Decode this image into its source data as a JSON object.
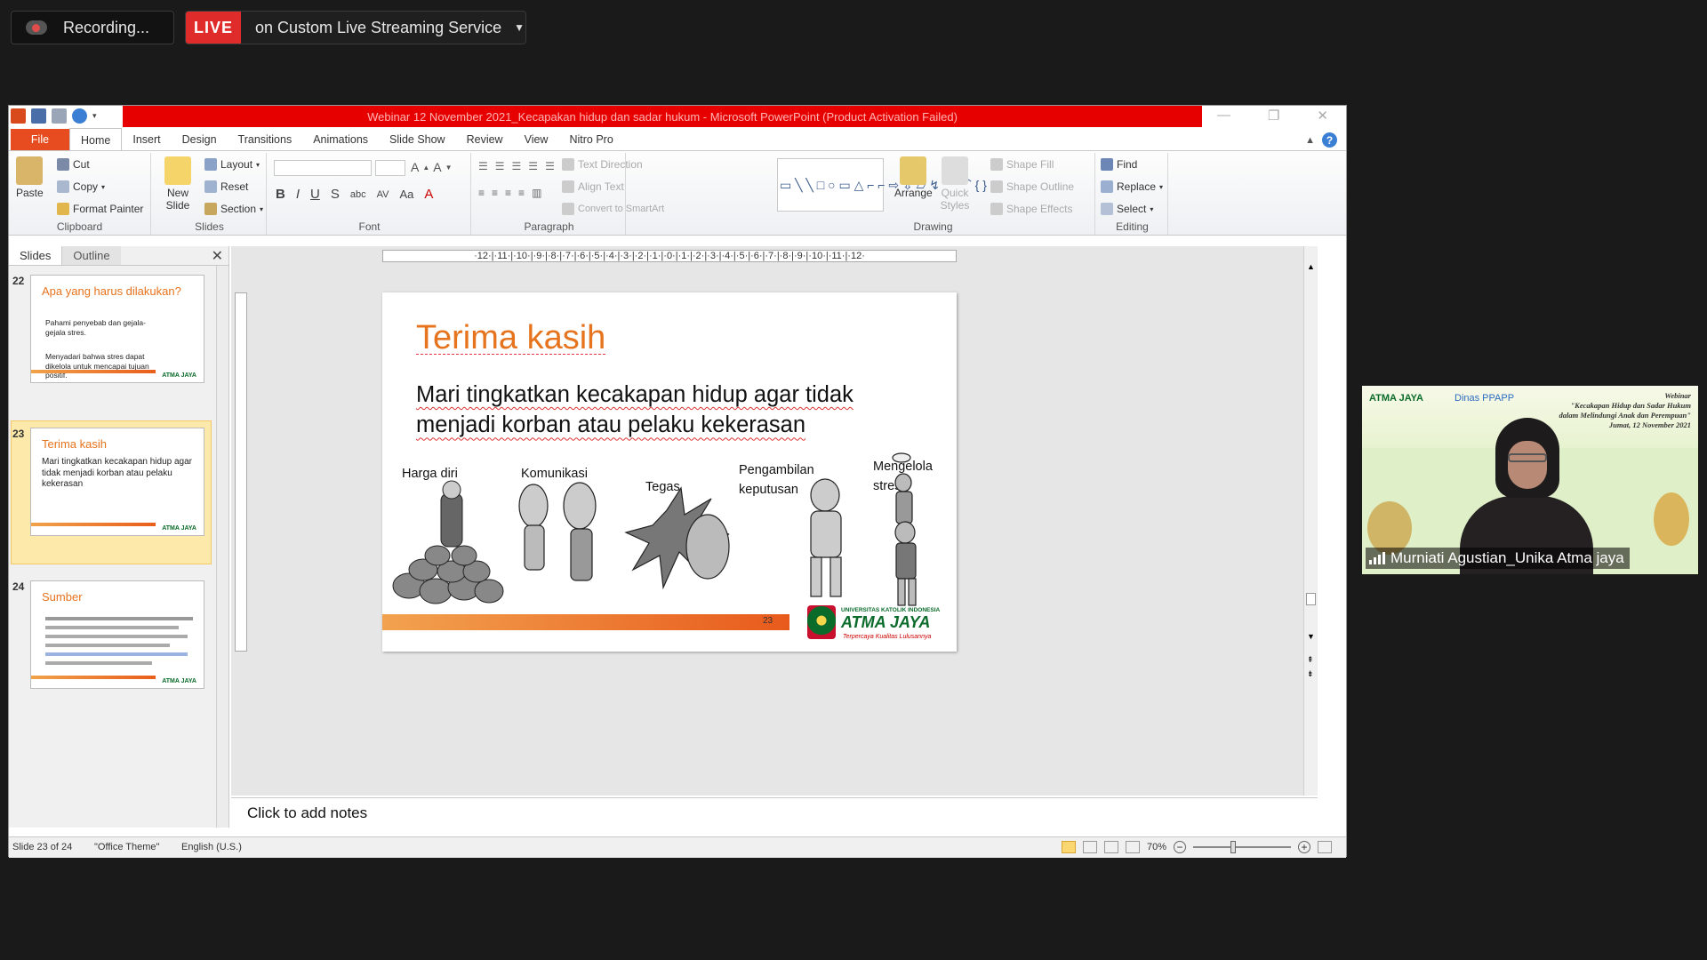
{
  "zoom": {
    "recording_label": "Recording...",
    "live_badge": "LIVE",
    "live_service": "on Custom Live Streaming Service"
  },
  "ppt": {
    "window_title": "Webinar 12 November 2021_Kecapakan hidup dan sadar hukum - Microsoft PowerPoint (Product Activation Failed)",
    "tabs": [
      "File",
      "Home",
      "Insert",
      "Design",
      "Transitions",
      "Animations",
      "Slide Show",
      "Review",
      "View",
      "Nitro Pro"
    ],
    "active_tab": "Home",
    "ribbon": {
      "clipboard": {
        "label": "Clipboard",
        "paste": "Paste",
        "cut": "Cut",
        "copy": "Copy",
        "format_painter": "Format Painter"
      },
      "slides": {
        "label": "Slides",
        "new_slide": "New Slide",
        "layout": "Layout",
        "reset": "Reset",
        "section": "Section"
      },
      "font": {
        "label": "Font"
      },
      "paragraph": {
        "label": "Paragraph",
        "text_direction": "Text Direction",
        "align_text": "Align Text",
        "convert_smartart": "Convert to SmartArt"
      },
      "drawing": {
        "label": "Drawing",
        "arrange": "Arrange",
        "quick_styles": "Quick Styles",
        "shape_fill": "Shape Fill",
        "shape_outline": "Shape Outline",
        "shape_effects": "Shape Effects"
      },
      "editing": {
        "label": "Editing",
        "find": "Find",
        "replace": "Replace",
        "select": "Select"
      }
    },
    "panel": {
      "tab_slides": "Slides",
      "tab_outline": "Outline",
      "thumbs": [
        {
          "num": "22",
          "title": "Apa yang harus dilakukan?",
          "line1": "Pahami penyebab dan gejala-gejala stres.",
          "line2": "Menyadari bahwa stres dapat dikelola untuk mencapai tujuan positif.",
          "logo": "ATMA JAYA"
        },
        {
          "num": "23",
          "title": "Terima kasih",
          "line1": "Mari tingkatkan kecakapan hidup agar tidak menjadi korban atau pelaku kekerasan",
          "logo": "ATMA JAYA"
        },
        {
          "num": "24",
          "title": "Sumber",
          "logo": "ATMA JAYA"
        }
      ]
    },
    "ruler": "·12·|·11·|·10·|·9·|·8·|·7·|·6·|·5·|·4·|·3·|·2·|·1·|·0·|·1·|·2·|·3·|·4·|·5·|·6·|·7·|·8·|·9·|·10·|·11·|·12·",
    "slide": {
      "title": "Terima kasih",
      "body": "Mari tingkatkan kecakapan hidup agar tidak menjadi korban atau pelaku kekerasan",
      "labels": {
        "harga_diri": "Harga diri",
        "komunikasi": "Komunikasi",
        "tegas": "Tegas",
        "pengambilan": "Pengambilan keputusan",
        "mengelola": "Mengelola stres"
      },
      "page_number": "23",
      "logo_small": "UNIVERSITAS KATOLIK INDONESIA",
      "logo_big": "ATMA JAYA",
      "logo_tagline": "Terpercaya Kualitas Lulusannya"
    },
    "notes_placeholder": "Click to add notes",
    "status": {
      "slide_info": "Slide 23 of 24",
      "theme": "\"Office Theme\"",
      "language": "English (U.S.)",
      "zoom": "70%"
    }
  },
  "video": {
    "org_logo": "ATMA JAYA",
    "partner_logo": "Dinas PPAPP",
    "webinar_title": "Webinar",
    "webinar_line1": "\"Kecakapan Hidup dan Sadar Hukum",
    "webinar_line2": "dalam Melindungi Anak dan Perempuan\"",
    "webinar_date": "Jumat, 12 November 2021",
    "participant_name": "Murniati Agustian_Unika Atma jaya"
  }
}
